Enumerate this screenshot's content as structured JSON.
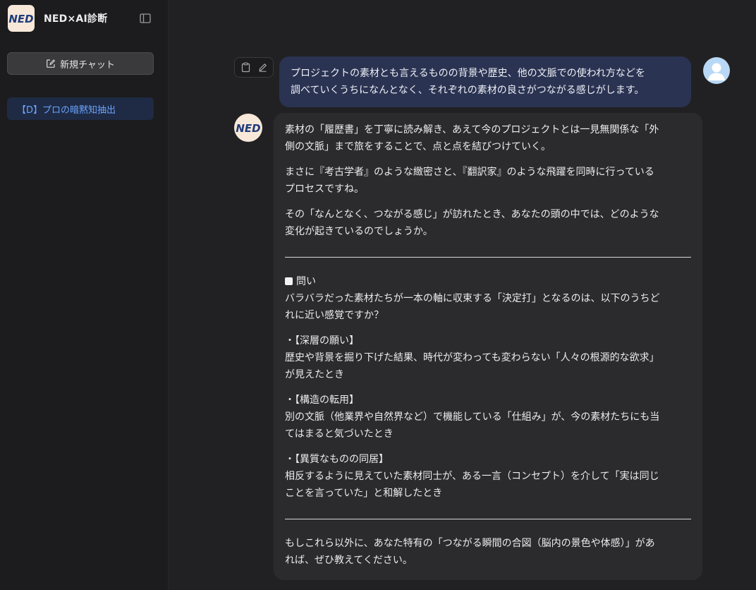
{
  "sidebar": {
    "logo_text": "NED",
    "app_title": "NED×AI診断",
    "new_chat_label": "新規チャット",
    "history": [
      {
        "label": "【D】プロの暗黙知抽出"
      }
    ]
  },
  "user_message": {
    "line1": "プロジェクトの素材とも言えるものの背景や歴史、他の文脈での使われ方などを",
    "line2": "調べていくうちになんとなく、それぞれの素材の良さがつながる感じがします。"
  },
  "bot_message": {
    "p1_line1": "素材の「履歴書」を丁寧に読み解き、あえて今のプロジェクトとは一見無関係な「外",
    "p1_line2": "側の文脈」まで旅をすることで、点と点を結びつけていく。",
    "p2_line1": "まさに『考古学者』のような緻密さと、『翻訳家』のような飛躍を同時に行っている",
    "p2_line2": "プロセスですね。",
    "p3_line1": "その「なんとなく、つながる感じ」が訪れたとき、あなたの頭の中では、どのような",
    "p3_line2": "変化が起きているのでしょうか。",
    "question_heading": "問い",
    "question_line1": "バラバラだった素材たちが一本の軸に収束する「決定打」となるのは、以下のうちど",
    "question_line2": "れに近い感覚ですか？",
    "options": [
      {
        "title": "・【深層の願い】",
        "line1": "歴史や背景を掘り下げた結果、時代が変わっても変わらない「人々の根源的な欲求」",
        "line2": "が見えたとき"
      },
      {
        "title": "・【構造の転用】",
        "line1": "別の文脈（他業界や自然界など）で機能している「仕組み」が、今の素材たちにも当",
        "line2": "てはまると気づいたとき"
      },
      {
        "title": "・【異質なものの同居】",
        "line1": "相反するように見えていた素材同士が、ある一言（コンセプト）を介して「実は同じ",
        "line2": "ことを言っていた」と和解したとき"
      }
    ],
    "closing_line1": "もしこれら以外に、あなた特有の「つながる瞬間の合図（脳内の景色や体感）」があ",
    "closing_line2": "れば、ぜひ教えてください。"
  },
  "colors": {
    "sidebar_bg": "#1c1c1e",
    "main_bg": "#212123",
    "user_bubble": "#2a3352",
    "bot_bubble": "#2b2b2e",
    "accent_link": "#6aa4ff",
    "logo_bg": "#f7e8d9",
    "logo_text": "#1f3a7a"
  },
  "icons": {
    "toggle": "sidebar-toggle-icon",
    "new_chat": "edit-square-icon",
    "copy": "clipboard-icon",
    "edit": "pencil-icon",
    "user": "user-avatar-icon"
  }
}
